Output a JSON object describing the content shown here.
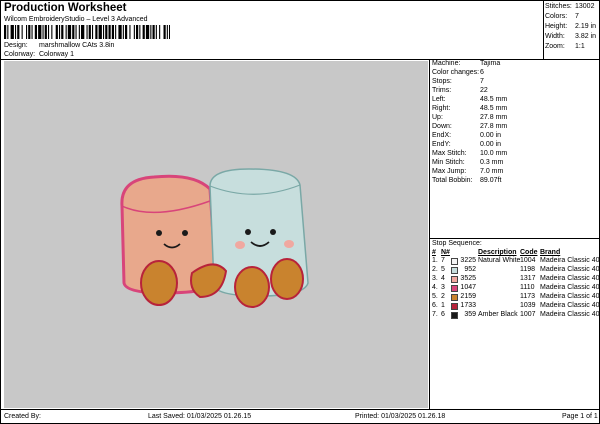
{
  "header": {
    "title": "Production Worksheet",
    "subtitle": "Wilcom EmbroideryStudio – Level 3 Advanced",
    "design_label": "Design:",
    "design_value": "marshmallow CAts 3.8in",
    "colorway_label": "Colorway:",
    "colorway_value": "Colorway 1"
  },
  "stats": [
    {
      "label": "Stitches:",
      "value": "13002"
    },
    {
      "label": "Colors:",
      "value": "7"
    },
    {
      "label": "Height:",
      "value": "2.19 in"
    },
    {
      "label": "Width:",
      "value": "3.82 in"
    },
    {
      "label": "Zoom:",
      "value": "1:1"
    }
  ],
  "specs": [
    {
      "label": "Machine:",
      "value": "Tajima"
    },
    {
      "label": "Color changes:",
      "value": "6"
    },
    {
      "label": "Stops:",
      "value": "7"
    },
    {
      "label": "Trims:",
      "value": "22"
    },
    {
      "label": "Left:",
      "value": "48.5 mm"
    },
    {
      "label": "Right:",
      "value": "48.5 mm"
    },
    {
      "label": "Up:",
      "value": "27.8 mm"
    },
    {
      "label": "Down:",
      "value": "27.8 mm"
    },
    {
      "label": "EndX:",
      "value": "0.00 in"
    },
    {
      "label": "EndY:",
      "value": "0.00 in"
    },
    {
      "label": "Max Stitch:",
      "value": "10.0 mm"
    },
    {
      "label": "Min Stitch:",
      "value": "0.3 mm"
    },
    {
      "label": "Max Jump:",
      "value": "7.0 mm"
    },
    {
      "label": "Total Bobbin:",
      "value": "89.07ft"
    }
  ],
  "sequence": {
    "title": "Stop Sequence:",
    "headers": {
      "num": "#",
      "n": "N#",
      "description": "Description",
      "code": "Code",
      "brand": "Brand"
    },
    "rows": [
      {
        "num": "1.",
        "n": "7",
        "color": "#f4f4f4",
        "code_num": "3225",
        "description": "Natural White",
        "code": "1004",
        "brand": "Madeira Classic 40"
      },
      {
        "num": "2.",
        "n": "5",
        "color": "#c7dedd",
        "code_num": "952",
        "description": "",
        "code": "1198",
        "brand": "Madeira Classic 40"
      },
      {
        "num": "3.",
        "n": "4",
        "color": "#f0a8a0",
        "code_num": "3525",
        "description": "",
        "code": "1317",
        "brand": "Madeira Classic 40"
      },
      {
        "num": "4.",
        "n": "3",
        "color": "#d8457a",
        "code_num": "1047",
        "description": "",
        "code": "1110",
        "brand": "Madeira Classic 40"
      },
      {
        "num": "5.",
        "n": "2",
        "color": "#c9832e",
        "code_num": "2159",
        "description": "",
        "code": "1173",
        "brand": "Madeira Classic 40"
      },
      {
        "num": "6.",
        "n": "1",
        "color": "#b8233a",
        "code_num": "1733",
        "description": "",
        "code": "1039",
        "brand": "Madeira Classic 40"
      },
      {
        "num": "7.",
        "n": "6",
        "color": "#1a1a1a",
        "code_num": "359",
        "description": "Amber Black",
        "code": "1007",
        "brand": "Madeira Classic 40"
      }
    ]
  },
  "footer": {
    "created_by": "Created By:",
    "last_saved": "Last Saved: 01/03/2025 01.26.15",
    "printed": "Printed: 01/03/2025 01.26.18",
    "page": "Page 1 of 1"
  },
  "colors": {
    "canvas_bg": "#c8c8c8",
    "left_body": "#e8a88c",
    "left_outline": "#d8457a",
    "right_body": "#c7dedd",
    "right_outline": "#7aa8a6",
    "feet": "#c9832e",
    "feet_outline": "#b8233a",
    "cheeks": "#f0a8a0",
    "eyes": "#1a1a1a"
  }
}
